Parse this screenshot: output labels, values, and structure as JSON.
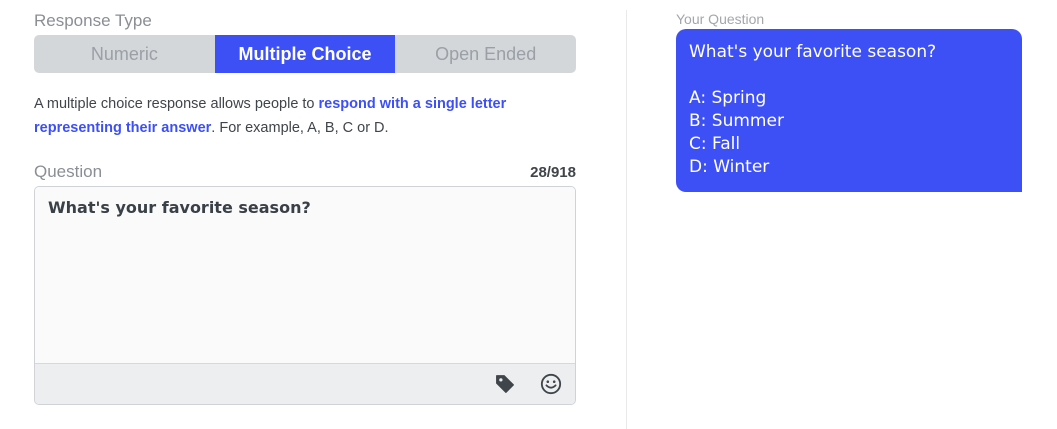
{
  "response_type": {
    "label": "Response Type",
    "options": [
      "Numeric",
      "Multiple Choice",
      "Open Ended"
    ],
    "selected": "Multiple Choice"
  },
  "description": {
    "prefix": "A multiple choice response allows people to ",
    "highlight": "respond with a single letter representing their answer",
    "suffix": ". For example, A, B, C or D."
  },
  "question": {
    "label": "Question",
    "counter": "28/918",
    "value": "What's your favorite season?"
  },
  "toolbar": {
    "icons": [
      "tag-icon",
      "emoji-icon"
    ]
  },
  "preview": {
    "label": "Your Question",
    "question": "What's your favorite season?",
    "options": [
      "A: Spring",
      "B: Summer",
      "C: Fall",
      "D: Winter"
    ]
  },
  "colors": {
    "accent": "#3d50f5",
    "segment_bg": "#d4d7da"
  }
}
